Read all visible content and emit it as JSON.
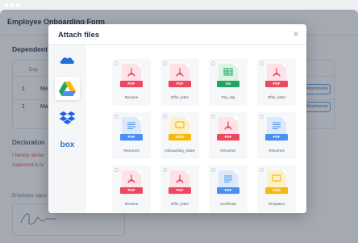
{
  "page": {
    "title": "Employee Onboarding Form",
    "section_title": "Dependent Information",
    "section_title_visible": "Dependent In",
    "table_header_dep": "Dep",
    "rows": [
      {
        "num": "1",
        "name": "Me"
      },
      {
        "num": "1",
        "name": "Ma"
      }
    ],
    "attach_label": "Attachments",
    "declaration_title": "Declaration",
    "declaration_lines": [
      "I hereby declar",
      "statement is fa"
    ],
    "signature_label": "Employee signa"
  },
  "modal": {
    "title": "Attach files",
    "close_icon": "close-icon",
    "providers": [
      {
        "id": "onedrive",
        "icon": "onedrive-icon",
        "color": "#1e6fd9",
        "active": false
      },
      {
        "id": "google-drive",
        "icon": "google-drive-icon",
        "color": "#1fa463",
        "active": true
      },
      {
        "id": "dropbox",
        "icon": "dropbox-icon",
        "color": "#1f63e0",
        "active": false
      },
      {
        "id": "box",
        "icon": "box-icon",
        "label": "box",
        "color": "#2a76d2",
        "active": false
      }
    ],
    "files": [
      {
        "name": "Resume",
        "type": "PDF",
        "color": "#ec4860",
        "tint": "#fde3e7"
      },
      {
        "name": "Offer_letter",
        "type": "PDF",
        "color": "#ec4860",
        "tint": "#fde3e7"
      },
      {
        "name": "Pay_slip",
        "type": "Xlx",
        "color": "#1fa463",
        "tint": "#dcf3e6"
      },
      {
        "name": "Offer_letter",
        "type": "PDF",
        "color": "#ec4860",
        "tint": "#fde3e7"
      },
      {
        "name": "Resume3",
        "type": "PDF",
        "color": "#4a8ff0",
        "tint": "#dce9fb"
      },
      {
        "name": "Onboarding_slides",
        "type": "Slide",
        "color": "#f5b914",
        "tint": "#fdf1cc"
      },
      {
        "name": "Resume2",
        "type": "PDF",
        "color": "#ec4860",
        "tint": "#fde3e7"
      },
      {
        "name": "Resume3",
        "type": "PDF",
        "color": "#4a8ff0",
        "tint": "#dce9fb"
      },
      {
        "name": "Resume",
        "type": "PDF",
        "color": "#ec4860",
        "tint": "#fde3e7"
      },
      {
        "name": "Offer_letter",
        "type": "PDF",
        "color": "#ec4860",
        "tint": "#fde3e7"
      },
      {
        "name": "Certificate",
        "type": "PDF",
        "color": "#4a8ff0",
        "tint": "#dce9fb"
      },
      {
        "name": "Template1",
        "type": "Slide",
        "color": "#f5b914",
        "tint": "#fdf1cc"
      }
    ]
  }
}
